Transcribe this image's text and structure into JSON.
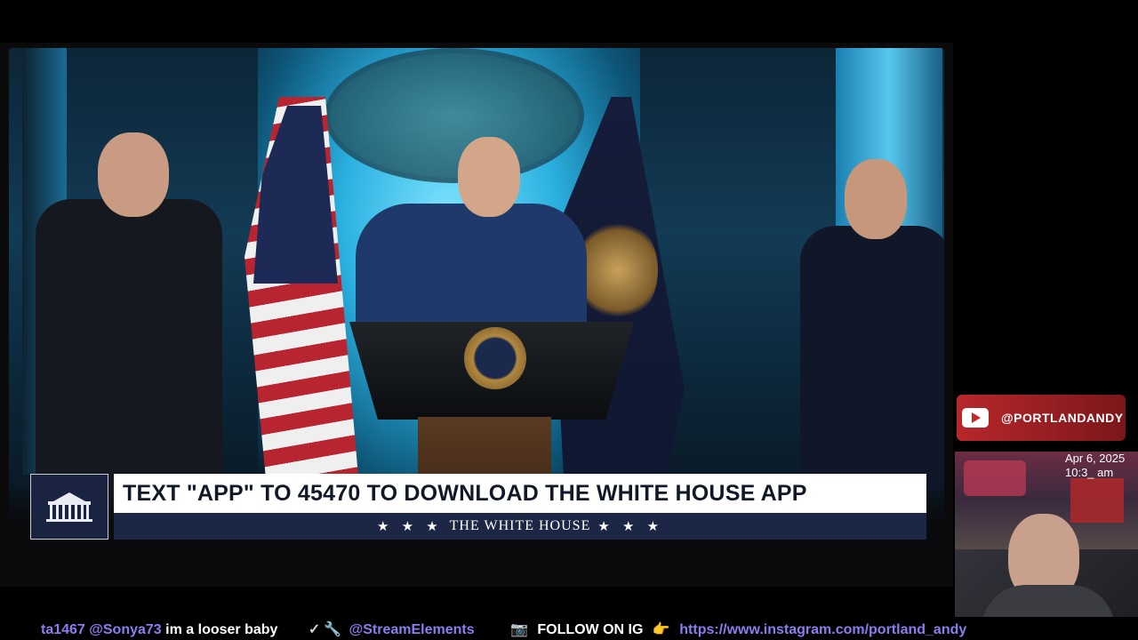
{
  "lower_third": {
    "headline": "TEXT \"APP\" TO 45470 TO DOWNLOAD THE WHITE HOUSE APP",
    "subtitle": "THE WHITE HOUSE",
    "stars": "★ ★ ★",
    "logo_icon": "white-house-icon"
  },
  "side_panel": {
    "channel_handle": "@PORTLANDANDY",
    "platform_icon": "youtube-icon",
    "webcam_date": "Apr 6, 2025",
    "webcam_time": "10:3_ am"
  },
  "ticker": {
    "user_fragment": "ta1467",
    "mention_user": "@Sonya73",
    "message": "im a looser baby",
    "icons": [
      "checkmark-icon",
      "wrench-icon"
    ],
    "bot_mention": "@StreamElements",
    "follow_text": "FOLLOW ON IG",
    "link": "https://www.instagram.com/portland_andy"
  },
  "colors": {
    "lower_third_navy": "#1c2746",
    "ticker_accent": "#8d7cf0",
    "youtube_red": "#b8272b"
  }
}
